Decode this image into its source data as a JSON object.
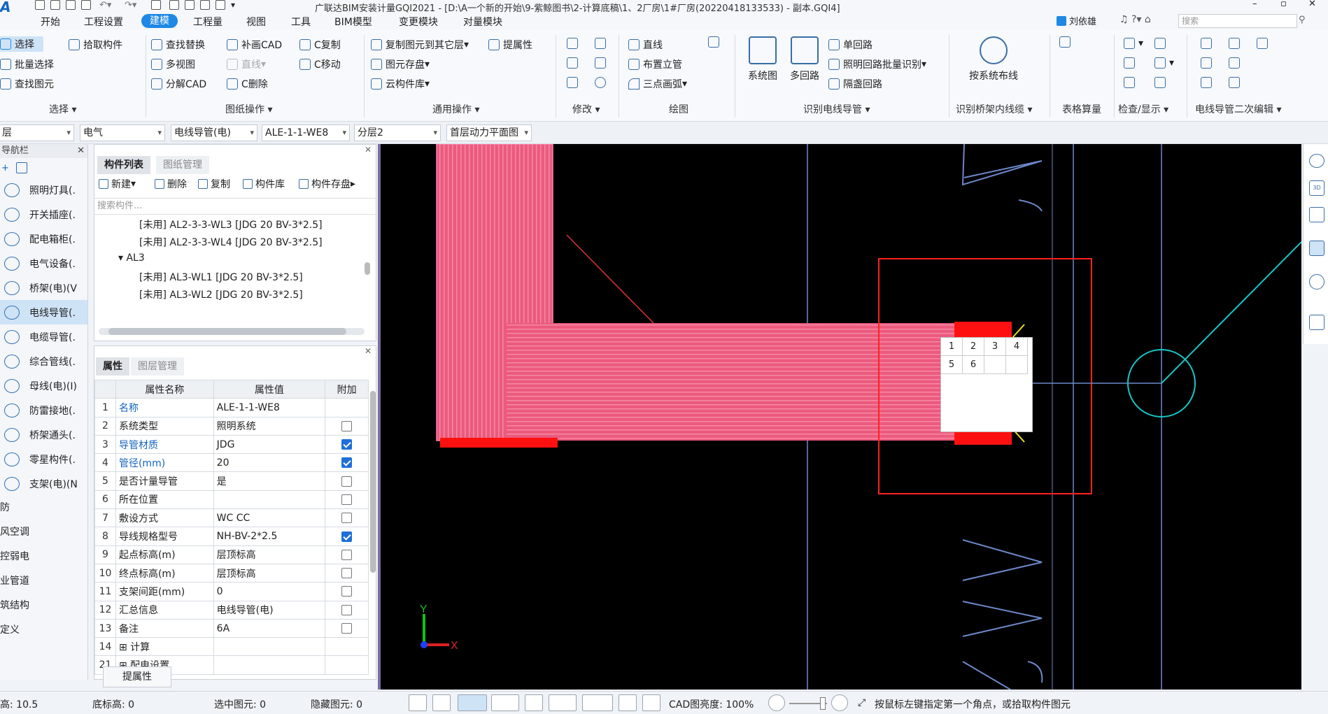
{
  "title": "广联达BIM安装计量GQI2021 - [D:\\A一个新的开始\\9-紫鲸图书\\2-计算底稿\\1、2厂房\\1#厂房(20220418133533) - 副本.GQI4]",
  "menu": [
    "开始",
    "工程设置",
    "建模",
    "工程量",
    "视图",
    "工具",
    "BIM模型",
    "变更模块",
    "对量模块"
  ],
  "menu_active": "建模",
  "user": "刘依雄",
  "search_placeholder": "搜索",
  "ribbon": {
    "select": {
      "items": [
        "选择",
        "拾取构件",
        "批量选择",
        "查找图元"
      ],
      "label": "选择"
    },
    "drawing_ops": {
      "items": [
        "查找替换",
        "补画CAD",
        "C复制",
        "多视图",
        "直线",
        "C移动",
        "分解CAD",
        "C删除"
      ],
      "label": "图纸操作"
    },
    "common_ops": {
      "items": [
        "复制图元到其它层",
        "提属性",
        "图元存盘",
        "云构件库"
      ],
      "label": "通用操作"
    },
    "modify": {
      "label": "修改"
    },
    "draw": {
      "items": [
        "直线",
        "布置立管",
        "三点画弧"
      ],
      "label": "绘图"
    },
    "recognize": {
      "items": [
        "系统图",
        "多回路",
        "单回路",
        "照明回路批量识别",
        "隔盏回路"
      ],
      "label": "识别电线导管"
    },
    "tray": {
      "items": [
        "按系统布线"
      ],
      "label": "识别桥架内线缆"
    },
    "table": {
      "label": "表格算量"
    },
    "check": {
      "label": "检查/显示"
    },
    "edit2": {
      "label": "电线导管二次编辑"
    }
  },
  "dropdowns": [
    "层",
    "电气",
    "电线导管(电)",
    "ALE-1-1-WE8",
    "分层2",
    "首层动力平面图"
  ],
  "nav": {
    "header": "导航栏",
    "items": [
      "照明灯具(.",
      "开关插座(.",
      "配电箱柜(.",
      "电气设备(.",
      "桥架(电)(V",
      "电线导管(.",
      "电缆导管(.",
      "综合管线(.",
      "母线(电)(I)",
      "防雷接地(.",
      "桥架通头(.",
      "零星构件(.",
      "支架(电)(N"
    ],
    "selected": "电线导管(.",
    "categories": [
      "防",
      "风空调",
      "控弱电",
      "业管道",
      "筑结构",
      "定义"
    ]
  },
  "component_panel": {
    "tabs": [
      "构件列表",
      "图纸管理"
    ],
    "toolbar": [
      "新建",
      "删除",
      "复制",
      "构件库",
      "构件存盘"
    ],
    "search_placeholder": "搜索构件...",
    "tree": [
      {
        "text": "[未用] AL2-3-3-WL3 [JDG 20 BV-3*2.5]",
        "indent": 2
      },
      {
        "text": "[未用] AL2-3-3-WL4 [JDG 20 BV-3*2.5]",
        "indent": 2
      },
      {
        "text": "▾ AL3",
        "indent": 1
      },
      {
        "text": "[未用] AL3-WL1 [JDG 20 BV-3*2.5]",
        "indent": 2
      },
      {
        "text": "[未用] AL3-WL2 [JDG 20 BV-3*2.5]",
        "indent": 2
      }
    ]
  },
  "property_panel": {
    "tabs": [
      "属性",
      "图层管理"
    ],
    "headers": [
      "属性名称",
      "属性值",
      "附加"
    ],
    "rows": [
      {
        "n": "1",
        "name": "名称",
        "value": "ALE-1-1-WE8",
        "chk": null,
        "blue": true
      },
      {
        "n": "2",
        "name": "系统类型",
        "value": "照明系统",
        "chk": false,
        "blue": false
      },
      {
        "n": "3",
        "name": "导管材质",
        "value": "JDG",
        "chk": true,
        "blue": true
      },
      {
        "n": "4",
        "name": "管径(mm)",
        "value": "20",
        "chk": true,
        "blue": true
      },
      {
        "n": "5",
        "name": "是否计量导管",
        "value": "是",
        "chk": false,
        "blue": false
      },
      {
        "n": "6",
        "name": "所在位置",
        "value": "",
        "chk": false,
        "blue": false
      },
      {
        "n": "7",
        "name": "敷设方式",
        "value": "WC CC",
        "chk": false,
        "blue": false
      },
      {
        "n": "8",
        "name": "导线规格型号",
        "value": "NH-BV-2*2.5",
        "chk": true,
        "blue": false
      },
      {
        "n": "9",
        "name": "起点标高(m)",
        "value": "层顶标高",
        "chk": false,
        "blue": false
      },
      {
        "n": "10",
        "name": "终点标高(m)",
        "value": "层顶标高",
        "chk": false,
        "blue": false
      },
      {
        "n": "11",
        "name": "支架间距(mm)",
        "value": "0",
        "chk": false,
        "blue": false
      },
      {
        "n": "12",
        "name": "汇总信息",
        "value": "电线导管(电)",
        "chk": false,
        "blue": false
      },
      {
        "n": "13",
        "name": "备注",
        "value": "6A",
        "chk": false,
        "blue": false
      },
      {
        "n": "14",
        "name": "⊞ 计算",
        "value": "",
        "chk": null,
        "blue": false
      },
      {
        "n": "21",
        "name": "⊞ 配电设置",
        "value": "",
        "chk": null,
        "blue": false
      }
    ],
    "button": "提属性"
  },
  "canvas": {
    "popup_numbers": [
      "1",
      "2",
      "3",
      "4",
      "5",
      "6"
    ],
    "axis_x": "X",
    "axis_y": "Y"
  },
  "status": {
    "height": "高: 10.5",
    "bottom_height": "底标高: 0",
    "selected": "选中图元: 0",
    "hidden": "隐藏图元: 0",
    "cad_brightness": "CAD图亮度: 100%",
    "hint": "按鼠标左键指定第一个角点，或拾取构件图元"
  },
  "colors": {
    "accent": "#1e88e5",
    "canvas_bg": "#000000",
    "conduit": "#f0577e",
    "select_box": "#ff2020",
    "grid": "#6d88c9",
    "cyan": "#16c6c6"
  }
}
